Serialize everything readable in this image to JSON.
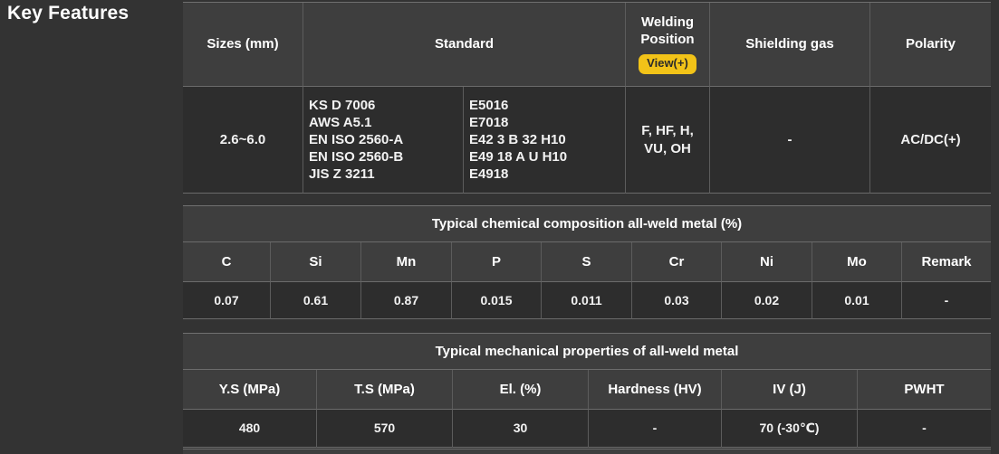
{
  "page_title": "Key Features",
  "accent_yellow": "#f2c318",
  "spec_table": {
    "headers": {
      "sizes": "Sizes (mm)",
      "standard": "Standard",
      "welding_position_line1": "Welding",
      "welding_position_line2": "Position",
      "view_button": "View(+)",
      "shielding_gas": "Shielding gas",
      "polarity": "Polarity"
    },
    "row": {
      "sizes": "2.6~6.0",
      "standard_col1": [
        "KS D 7006",
        "AWS A5.1",
        "EN ISO 2560-A",
        "EN ISO 2560-B",
        "JIS Z 3211"
      ],
      "standard_col2": [
        "E5016",
        "E7018",
        "E42 3 B 32 H10",
        "E49 18 A U H10",
        "E4918"
      ],
      "welding_position": "F, HF, H, VU, OH",
      "shielding_gas": "-",
      "polarity": "AC/DC(+)"
    }
  },
  "chem_table": {
    "title": "Typical chemical composition all-weld metal (%)",
    "headers": [
      "C",
      "Si",
      "Mn",
      "P",
      "S",
      "Cr",
      "Ni",
      "Mo",
      "Remark"
    ],
    "values": [
      "0.07",
      "0.61",
      "0.87",
      "0.015",
      "0.011",
      "0.03",
      "0.02",
      "0.01",
      "-"
    ]
  },
  "mech_table": {
    "title": "Typical mechanical properties of all-weld metal",
    "headers": [
      "Y.S (MPa)",
      "T.S (MPa)",
      "El. (%)",
      "Hardness (HV)",
      "IV (J)",
      "PWHT"
    ],
    "values": [
      "480",
      "570",
      "30",
      "-",
      "70 (-30℃)",
      "-"
    ]
  }
}
